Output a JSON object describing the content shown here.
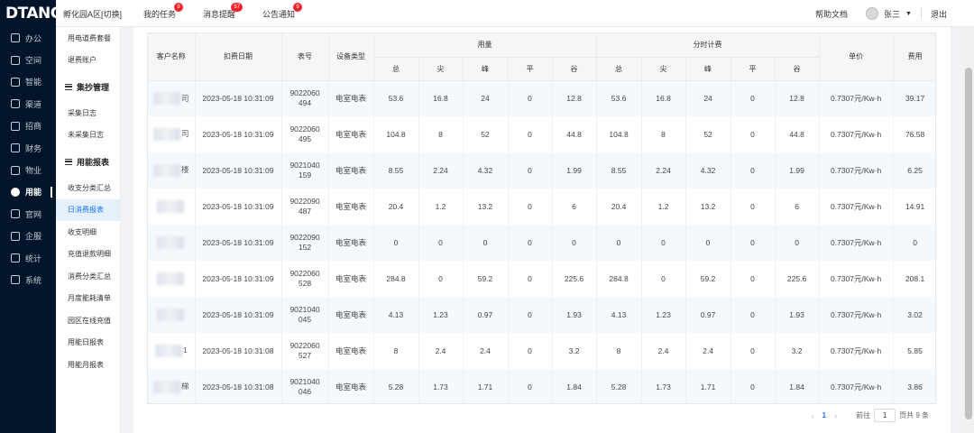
{
  "logo": "DTANG",
  "top": {
    "park": "孵化园A区[切换]",
    "tasks": {
      "label": "我的任务",
      "badge": "9"
    },
    "messages": {
      "label": "消息提醒",
      "badge": "57"
    },
    "notices": {
      "label": "公告通知",
      "badge": "9"
    },
    "help": "帮助文档",
    "user": "张三",
    "logout": "退出"
  },
  "nav": [
    "办公",
    "空间",
    "智能",
    "渠道",
    "招商",
    "财务",
    "物业",
    "用能",
    "官网",
    "企服",
    "统计",
    "系统"
  ],
  "nav_active_index": 7,
  "submenu": {
    "items_top": [
      "用电道费套餐",
      "退费账户"
    ],
    "group1": "集抄管理",
    "group1_items": [
      "采集日志",
      "未采集日志"
    ],
    "group2": "用能报表",
    "group2_items": [
      "收支分类汇总",
      "日消费报表",
      "收支明细",
      "充值退款明细",
      "消费分类汇总",
      "月度能耗清单",
      "园区在线充值",
      "用能日报表",
      "用能月报表"
    ],
    "active": "日消费报表"
  },
  "table": {
    "headers": {
      "customer": "客户名称",
      "date": "扣费日期",
      "meter": "表号",
      "device": "设备类型",
      "usage": "用量",
      "tou": "分时计费",
      "price": "单价",
      "fee": "费用",
      "sub": [
        "总",
        "尖",
        "峰",
        "平",
        "谷",
        "总",
        "尖",
        "峰",
        "平",
        "谷"
      ]
    },
    "rows": [
      {
        "suffix": "司",
        "date": "2023-05-18 10:31:09",
        "meter": "9022060494",
        "device": "电室电表",
        "u": [
          "53.6",
          "16.8",
          "24",
          "0",
          "12.8"
        ],
        "t": [
          "53.6",
          "16.8",
          "24",
          "0",
          "12.8"
        ],
        "price": "0.7307元/Kw·h",
        "fee": "39.17"
      },
      {
        "suffix": "司",
        "date": "2023-05-18 10:31:09",
        "meter": "9022060495",
        "device": "电室电表",
        "u": [
          "104.8",
          "8",
          "52",
          "0",
          "44.8"
        ],
        "t": [
          "104.8",
          "8",
          "52",
          "0",
          "44.8"
        ],
        "price": "0.7307元/Kw·h",
        "fee": "76.58"
      },
      {
        "suffix": "楼",
        "date": "2023-05-18 10:31:09",
        "meter": "9021040159",
        "device": "电室电表",
        "u": [
          "8.55",
          "2.24",
          "4.32",
          "0",
          "1.99"
        ],
        "t": [
          "8.55",
          "2.24",
          "4.32",
          "0",
          "1.99"
        ],
        "price": "0.7307元/Kw·h",
        "fee": "6.25"
      },
      {
        "suffix": "",
        "date": "2023-05-18 10:31:09",
        "meter": "9022090487",
        "device": "电室电表",
        "u": [
          "20.4",
          "1.2",
          "13.2",
          "0",
          "6"
        ],
        "t": [
          "20.4",
          "1.2",
          "13.2",
          "0",
          "6"
        ],
        "price": "0.7307元/Kw·h",
        "fee": "14.91"
      },
      {
        "suffix": "",
        "date": "2023-05-18 10:31:09",
        "meter": "9022090152",
        "device": "电室电表",
        "u": [
          "0",
          "0",
          "0",
          "0",
          "0"
        ],
        "t": [
          "0",
          "0",
          "0",
          "0",
          "0"
        ],
        "price": "0.7307元/Kw·h",
        "fee": "0"
      },
      {
        "suffix": "",
        "date": "2023-05-18 10:31:09",
        "meter": "9022060528",
        "device": "电室电表",
        "u": [
          "284.8",
          "0",
          "59.2",
          "0",
          "225.6"
        ],
        "t": [
          "284.8",
          "0",
          "59.2",
          "0",
          "225.6"
        ],
        "price": "0.7307元/Kw·h",
        "fee": "208.1"
      },
      {
        "suffix": "",
        "date": "2023-05-18 10:31:09",
        "meter": "9021040045",
        "device": "电室电表",
        "u": [
          "4.13",
          "1.23",
          "0.97",
          "0",
          "1.93"
        ],
        "t": [
          "4.13",
          "1.23",
          "0.97",
          "0",
          "1.93"
        ],
        "price": "0.7307元/Kw·h",
        "fee": "3.02"
      },
      {
        "suffix": "1",
        "date": "2023-05-18 10:31:08",
        "meter": "9022060527",
        "device": "电室电表",
        "u": [
          "8",
          "2.4",
          "2.4",
          "0",
          "3.2"
        ],
        "t": [
          "8",
          "2.4",
          "2.4",
          "0",
          "3.2"
        ],
        "price": "0.7307元/Kw·h",
        "fee": "5.85"
      },
      {
        "suffix": "梯",
        "date": "2023-05-18 10:31:08",
        "meter": "9021040046",
        "device": "电室电表",
        "u": [
          "5.28",
          "1.73",
          "1.71",
          "0",
          "1.84"
        ],
        "t": [
          "5.28",
          "1.73",
          "1.71",
          "0",
          "1.84"
        ],
        "price": "0.7307元/Kw·h",
        "fee": "3.86"
      }
    ]
  },
  "pager": {
    "page": "1",
    "goto": "前往",
    "page_input": "1",
    "total": "页共 9 条",
    "prev": "‹",
    "next": "›"
  }
}
